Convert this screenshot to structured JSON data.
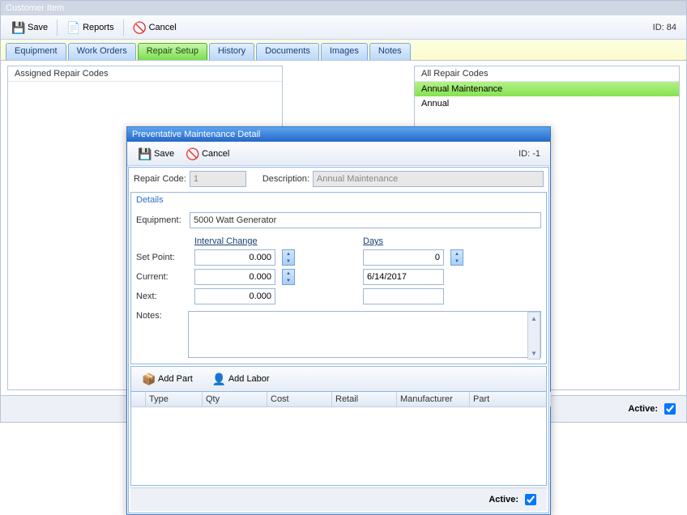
{
  "outer": {
    "title": "Customer Item",
    "toolbar": {
      "save": "Save",
      "reports": "Reports",
      "cancel": "Cancel"
    },
    "id_label": "ID: 84",
    "tabs": [
      "Equipment",
      "Work Orders",
      "Repair Setup",
      "History",
      "Documents",
      "Images",
      "Notes"
    ],
    "active_tab": 2,
    "assigned_title": "Assigned Repair Codes",
    "all_title": "All Repair Codes",
    "all_items": [
      "Annual Maintenance",
      "Annual"
    ],
    "active_label": "Active:"
  },
  "dialog": {
    "title": "Preventative Maintenance Detail",
    "toolbar": {
      "save": "Save",
      "cancel": "Cancel"
    },
    "id_label": "ID: -1",
    "repair_code_label": "Repair Code:",
    "repair_code_value": "1",
    "description_label": "Description:",
    "description_value": "Annual Maintenance",
    "details_title": "Details",
    "equipment_label": "Equipment:",
    "equipment_value": "5000 Watt Generator",
    "col_interval": "Interval Change",
    "col_days": "Days",
    "row_setpoint": "Set Point:",
    "row_current": "Current:",
    "row_next": "Next:",
    "setpoint_val": "0.000",
    "current_val": "0.000",
    "next_val": "0.000",
    "days_setpoint": "0",
    "days_current": "6/14/2017",
    "days_next": "",
    "notes_label": "Notes:",
    "add_part": "Add Part",
    "add_labor": "Add Labor",
    "cols": [
      "",
      "Type",
      "Qty",
      "Cost",
      "Retail",
      "Manufacturer",
      "Part"
    ],
    "active_label": "Active:"
  }
}
